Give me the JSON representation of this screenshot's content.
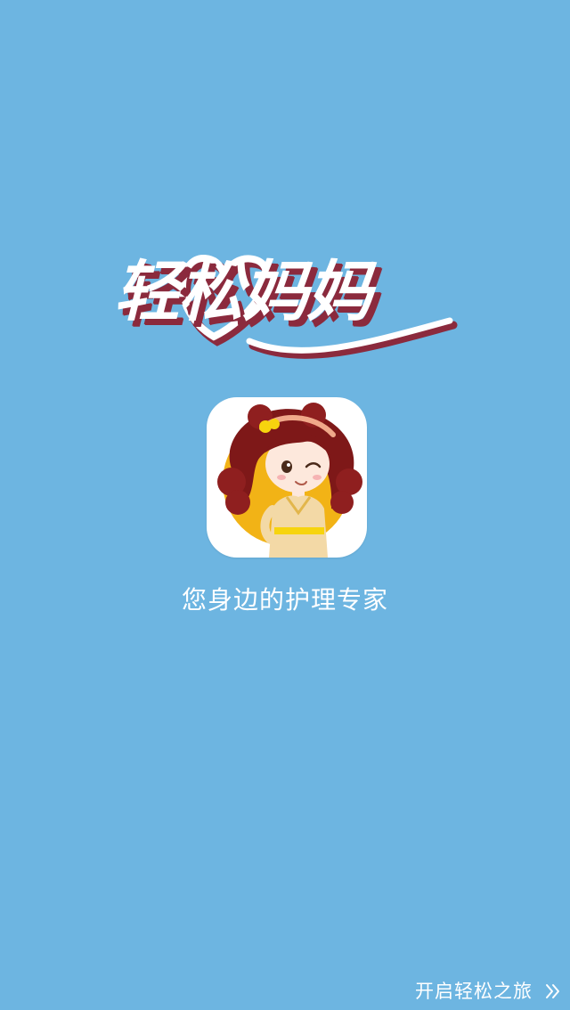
{
  "app": {
    "name": "轻松妈妈",
    "tagline": "您身边的护理专家"
  },
  "actions": {
    "start_label": "开启轻松之旅",
    "start_icon": "double-chevron-right-icon"
  },
  "colors": {
    "background": "#6db5e1",
    "logo_text": "#ffffff",
    "logo_shadow": "#8b2a3d",
    "icon_ring": "#f2b316"
  }
}
